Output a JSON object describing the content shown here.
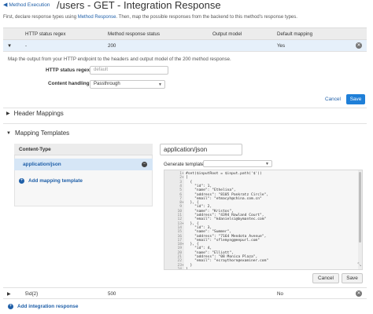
{
  "header": {
    "back_label": "Method Execution",
    "title": "/users - GET - Integration Response",
    "intro_before": "First, declare response types using ",
    "intro_link": "Method Response",
    "intro_after": ". Then, map the possible responses from the backend to this method's response types."
  },
  "grid": {
    "columns": [
      "HTTP status regex",
      "Method response status",
      "Output model",
      "Default mapping"
    ],
    "rows": [
      {
        "regex": "-",
        "status": "200",
        "model": "",
        "default": "Yes"
      },
      {
        "regex": "5\\d{2}",
        "status": "500",
        "model": "",
        "default": "No"
      }
    ]
  },
  "detail": {
    "description": "Map the output from your HTTP endpoint to the headers and output model of the 200 method response.",
    "regex_label": "HTTP status regex",
    "regex_placeholder": "default",
    "handling_label": "Content handling",
    "handling_value": "Passthrough",
    "cancel_label": "Cancel",
    "save_label": "Save"
  },
  "sections": {
    "header_mappings": "Header Mappings",
    "mapping_templates": "Mapping Templates"
  },
  "templates": {
    "content_type_header": "Content-Type",
    "items": [
      "application/json"
    ],
    "add_label": "Add mapping template",
    "active_type": "application/json",
    "generate_label": "Generate template:",
    "generate_value": ""
  },
  "code_lines": [
    {
      "n": "1",
      "fold": true,
      "t": "#set($inputRoot = $input.path('$'))"
    },
    {
      "n": "2",
      "fold": true,
      "t": "["
    },
    {
      "n": "3",
      "t": "  {"
    },
    {
      "n": "4",
      "t": "    \"id\": 1,"
    },
    {
      "n": "5",
      "t": "    \"name\": \"Ethelina\","
    },
    {
      "n": "6",
      "t": "    \"address\": \"8105 Pankratz Circle\","
    },
    {
      "n": "7",
      "t": "    \"email\": \"etmacyh@china.com.cn\""
    },
    {
      "n": "8",
      "fold": true,
      "t": "  }, {"
    },
    {
      "n": "9",
      "t": "    \"id\": 2,"
    },
    {
      "n": "10",
      "t": "    \"name\": \"Kristos\","
    },
    {
      "n": "11",
      "t": "    \"address\": \"4394 Rowland Court\","
    },
    {
      "n": "12",
      "t": "    \"email\": \"kdanielsi@bymantec.com\""
    },
    {
      "n": "13",
      "fold": true,
      "t": "  }, {"
    },
    {
      "n": "14",
      "t": "    \"id\": 3,"
    },
    {
      "n": "15",
      "t": "    \"name\": \"Summer\","
    },
    {
      "n": "16",
      "t": "    \"address\": \"7164 Mendota Avenue\","
    },
    {
      "n": "17",
      "t": "    \"email\": \"sflemyng@eepurl.com\""
    },
    {
      "n": "18",
      "fold": true,
      "t": "  }, {"
    },
    {
      "n": "19",
      "t": "    \"id\": 4,"
    },
    {
      "n": "20",
      "t": "    \"name\": \"Elliott\","
    },
    {
      "n": "21",
      "t": "    \"address\": \"08 Monica Plaza\","
    },
    {
      "n": "22",
      "t": "    \"email\": \"ecraythorn@examiner.com\""
    },
    {
      "n": "23",
      "fold": true,
      "t": "  }"
    },
    {
      "n": "24",
      "t": "]"
    }
  ],
  "editor_buttons": {
    "cancel": "Cancel",
    "save": "Save"
  },
  "footer": {
    "add_response": "Add integration response"
  },
  "colors": {
    "accent": "#1f7fd8",
    "link": "#1f5fa8",
    "selected_row": "#e6f0fa"
  }
}
